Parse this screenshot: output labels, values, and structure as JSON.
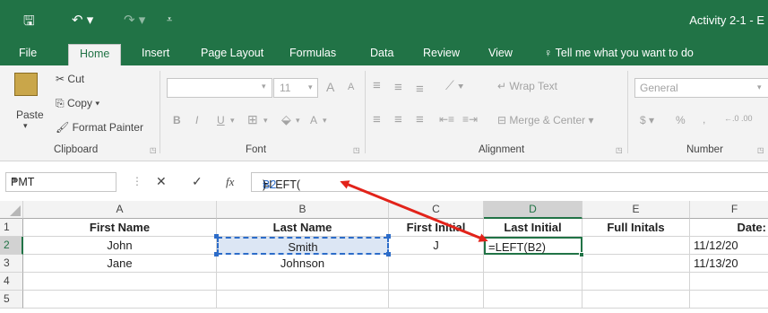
{
  "titlebar": {
    "title": "Activity 2-1 - E",
    "icons": [
      "save-icon",
      "undo-icon",
      "redo-icon",
      "customize-qat-icon"
    ]
  },
  "tabs": [
    "File",
    "Home",
    "Insert",
    "Page Layout",
    "Formulas",
    "Data",
    "Review",
    "View"
  ],
  "active_tab": "Home",
  "tell_me": "Tell me what you want to do",
  "ribbon": {
    "clipboard": {
      "paste": "Paste",
      "cut": "Cut",
      "copy": "Copy",
      "format_painter": "Format Painter",
      "label": "Clipboard"
    },
    "font": {
      "size": "11",
      "grow": "A",
      "shrink": "A",
      "bold": "B",
      "italic": "I",
      "underline": "U",
      "font_color": "A",
      "label": "Font"
    },
    "alignment": {
      "wrap_text": "Wrap Text",
      "merge_center": "Merge & Center",
      "label": "Alignment"
    },
    "number": {
      "format": "General",
      "currency": "$",
      "percent": "%",
      "comma": ",",
      "inc_decimal": "←.0 .00",
      "dec_decimal": ".00 →.0",
      "label": "Number"
    }
  },
  "formula_bar": {
    "name_box": "PMT",
    "cancel": "✕",
    "enter": "✓",
    "fx": "fx",
    "formula_prefix": "=LEFT(",
    "formula_ref": "B2",
    "formula_suffix": ")"
  },
  "columns": [
    "A",
    "B",
    "C",
    "D",
    "E",
    "F"
  ],
  "rows": [
    "1",
    "2",
    "3",
    "4",
    "5"
  ],
  "cells": {
    "A1": "First Name",
    "B1": "Last Name",
    "C1": "First Initial",
    "D1": "Last Initial",
    "E1": "Full Initals",
    "F1": "Date:",
    "A2": "John",
    "B2": "Smith",
    "C2": "J",
    "D2": "=LEFT(B2)",
    "E2": "",
    "F2": "11/12/20",
    "A3": "Jane",
    "B3": "Johnson",
    "C3": "",
    "D3": "",
    "E3": "",
    "F3": "11/13/20"
  },
  "colors": {
    "excel_green": "#217346",
    "ref_blue": "#2c6cc9",
    "arrow_red": "#e2231a"
  }
}
